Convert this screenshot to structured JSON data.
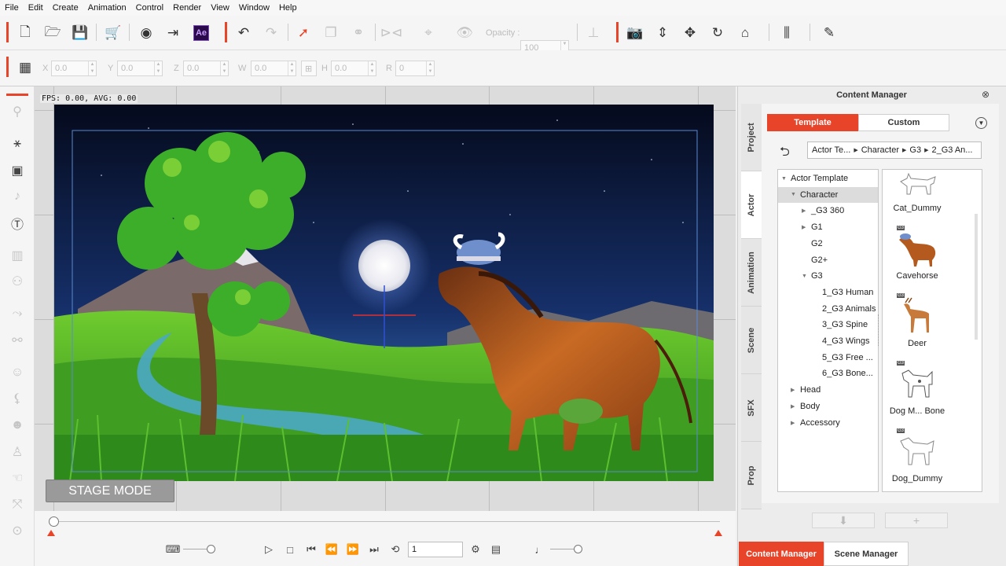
{
  "menu": [
    "File",
    "Edit",
    "Create",
    "Animation",
    "Control",
    "Render",
    "View",
    "Window",
    "Help"
  ],
  "toolbar": {
    "ae_label": "Ae",
    "opacity_label": "Opacity :",
    "opacity_value": "100"
  },
  "transform": {
    "x_label": "X",
    "x_value": "0.0",
    "y_label": "Y",
    "y_value": "0.0",
    "z_label": "Z",
    "z_value": "0.0",
    "w_label": "W",
    "w_value": "0.0",
    "h_label": "H",
    "h_value": "0.0",
    "r_label": "R",
    "r_value": "0"
  },
  "stage": {
    "fps_text": "FPS: 0.00, AVG: 0.00",
    "mode_label": "STAGE MODE"
  },
  "timeline": {
    "frame_value": "1",
    "progress": 0
  },
  "content_manager": {
    "title": "Content Manager",
    "vertical_tabs": [
      "Project",
      "Actor",
      "Animation",
      "Scene",
      "SFX",
      "Prop"
    ],
    "active_vertical_tab": "Actor",
    "tabs": {
      "template": "Template",
      "custom": "Custom"
    },
    "breadcrumb": [
      "Actor Te...",
      "Character",
      "G3",
      "2_G3 An..."
    ],
    "tree": [
      {
        "label": "Actor Template",
        "level": 0,
        "twisty": "open"
      },
      {
        "label": "Character",
        "level": 1,
        "twisty": "open",
        "selected": true
      },
      {
        "label": "_G3 360",
        "level": 2,
        "twisty": "closed"
      },
      {
        "label": "G1",
        "level": 2,
        "twisty": "closed"
      },
      {
        "label": "G2",
        "level": 2,
        "twisty": "none"
      },
      {
        "label": "G2+",
        "level": 2,
        "twisty": "none"
      },
      {
        "label": "G3",
        "level": 2,
        "twisty": "open"
      },
      {
        "label": "1_G3 Human",
        "level": 3,
        "twisty": "none"
      },
      {
        "label": "2_G3 Animals",
        "level": 3,
        "twisty": "none"
      },
      {
        "label": "3_G3 Spine",
        "level": 3,
        "twisty": "none"
      },
      {
        "label": "4_G3 Wings",
        "level": 3,
        "twisty": "none"
      },
      {
        "label": "5_G3 Free ...",
        "level": 3,
        "twisty": "none"
      },
      {
        "label": "6_G3 Bone...",
        "level": 3,
        "twisty": "none"
      },
      {
        "label": "Head",
        "level": 1,
        "twisty": "closed"
      },
      {
        "label": "Body",
        "level": 1,
        "twisty": "closed"
      },
      {
        "label": "Accessory",
        "level": 1,
        "twisty": "closed"
      }
    ],
    "items": [
      {
        "label": "Cat_Dummy"
      },
      {
        "label": "Cavehorse"
      },
      {
        "label": "Deer"
      },
      {
        "label": "Dog M... Bone"
      },
      {
        "label": "Dog_Dummy"
      }
    ],
    "badge_text": "G3"
  },
  "bottom_tabs": {
    "content_manager": "Content Manager",
    "scene_manager": "Scene Manager"
  },
  "colors": {
    "accent": "#e8442a",
    "sky": "#0a1230",
    "grass": "#3fa82c",
    "horse": "#b45a1e"
  }
}
